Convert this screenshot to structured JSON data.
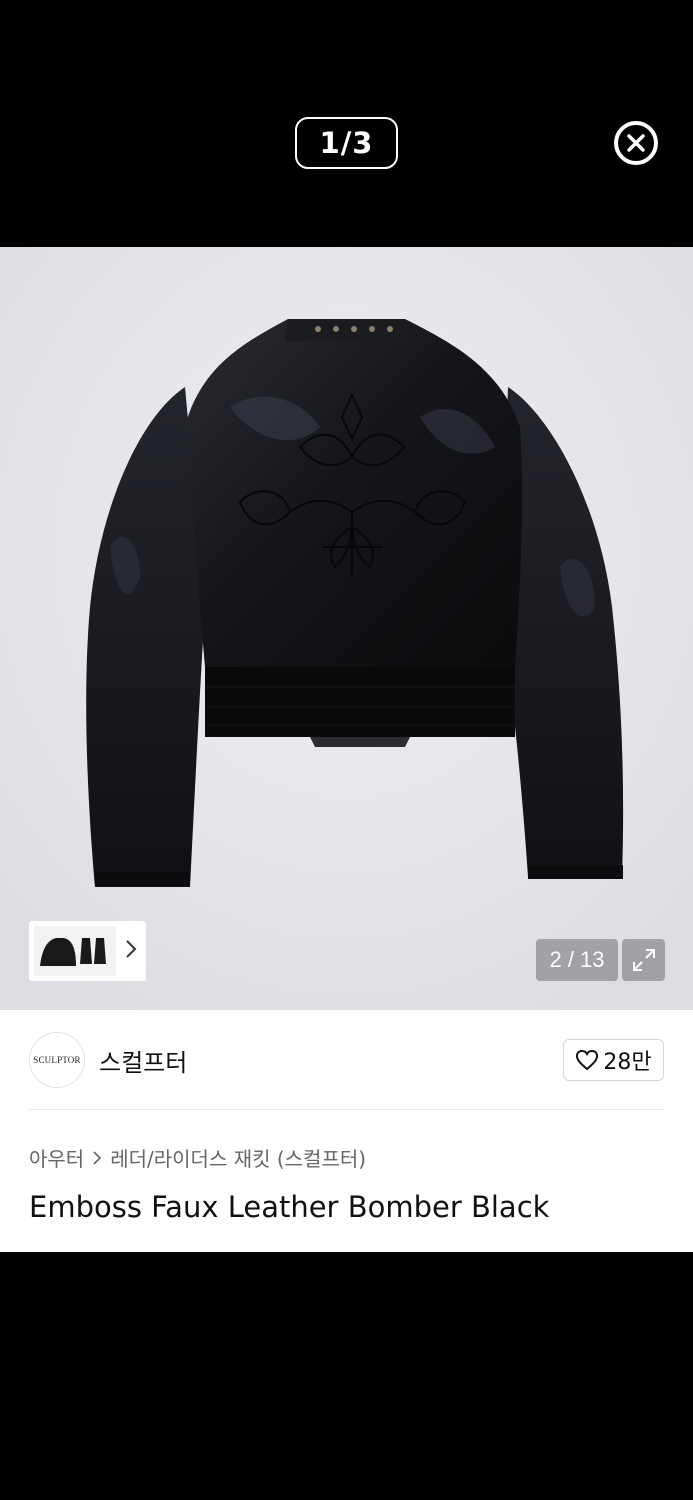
{
  "viewer": {
    "counter": "1/3"
  },
  "gallery": {
    "page_indicator": "2 / 13"
  },
  "brand": {
    "logo_text": "SCULPTOR",
    "name": "스컬프터",
    "likes": "28만"
  },
  "breadcrumb": {
    "category": "아우터",
    "subcategory": "레더/라이더스 재킷 (스컬프터)"
  },
  "product": {
    "title": "Emboss Faux Leather Bomber Black"
  },
  "icons": [
    "close-icon",
    "chevron-right-icon",
    "expand-icon",
    "heart-icon"
  ],
  "colors": {
    "background": "#000000",
    "photo_background": "#e8e8ec",
    "text": "#111111",
    "muted_text": "#666666"
  }
}
